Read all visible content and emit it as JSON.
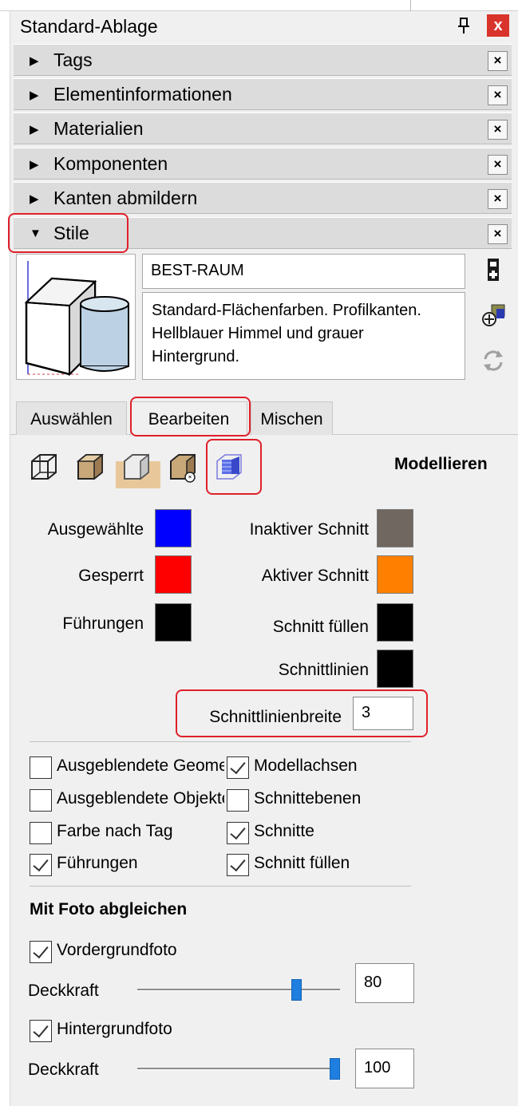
{
  "panel": {
    "title": "Standard-Ablage",
    "close_glyph": "x"
  },
  "sections": [
    {
      "label": "Tags",
      "expanded": false
    },
    {
      "label": "Elementinformationen",
      "expanded": false
    },
    {
      "label": "Materialien",
      "expanded": false
    },
    {
      "label": "Komponenten",
      "expanded": false
    },
    {
      "label": "Kanten abmildern",
      "expanded": false
    },
    {
      "label": "Stile",
      "expanded": true
    }
  ],
  "section_close_glyph": "×",
  "style": {
    "name": "BEST-RAUM",
    "description": "Standard-Flächenfarben. Profilkanten. Hellblauer Himmel und grauer Hintergrund."
  },
  "tabs": {
    "select": "Auswählen",
    "edit": "Bearbeiten",
    "mix": "Mischen",
    "active": "Bearbeiten"
  },
  "edit_mode": {
    "label": "Modellieren",
    "icons": [
      "edge-settings-icon",
      "face-settings-icon",
      "background-settings-icon",
      "watermark-settings-icon",
      "modeling-settings-icon"
    ],
    "selected_icon": "modeling-settings-icon"
  },
  "colors": {
    "selected": {
      "label": "Ausgewählte",
      "color": "#0000ff"
    },
    "locked": {
      "label": "Gesperrt",
      "color": "#ff0000"
    },
    "guides": {
      "label": "Führungen",
      "color": "#000000"
    },
    "inactive_section": {
      "label": "Inaktiver Schnitt",
      "color": "#706860"
    },
    "active_section": {
      "label": "Aktiver Schnitt",
      "color": "#ff8000"
    },
    "section_fill": {
      "label": "Schnitt füllen",
      "color": "#000000"
    },
    "section_lines": {
      "label": "Schnittlinien",
      "color": "#000000"
    }
  },
  "section_line_width": {
    "label": "Schnittlinienbreite",
    "value": "3"
  },
  "checkboxes": [
    {
      "label": "Ausgeblendete Geometrie",
      "checked": false
    },
    {
      "label": "Modellachsen",
      "checked": true
    },
    {
      "label": "Ausgeblendete Objekte",
      "checked": false
    },
    {
      "label": "Schnittebenen",
      "checked": false
    },
    {
      "label": "Farbe nach Tag",
      "checked": false
    },
    {
      "label": "Schnitte",
      "checked": true
    },
    {
      "label": "Führungen",
      "checked": true
    },
    {
      "label": "Schnitt füllen",
      "checked": true
    }
  ],
  "photo": {
    "heading": "Mit Foto abgleichen",
    "foreground": {
      "label": "Vordergrundfoto",
      "checked": true,
      "opacity_label": "Deckkraft",
      "opacity": "80"
    },
    "background": {
      "label": "Hintergrundfoto",
      "checked": true,
      "opacity_label": "Deckkraft",
      "opacity": "100"
    }
  }
}
